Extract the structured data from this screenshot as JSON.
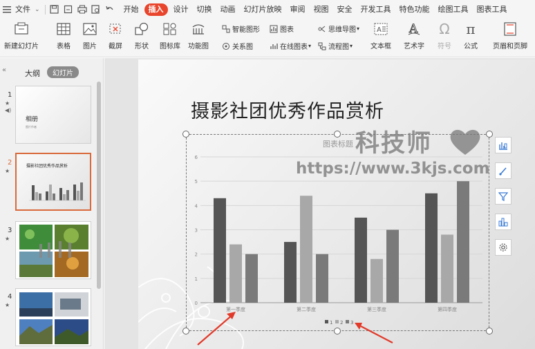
{
  "menu": {
    "file_label": "文件",
    "items": [
      "开始",
      "插入",
      "设计",
      "切换",
      "动画",
      "幻灯片放映",
      "审阅",
      "视图",
      "安全",
      "开发工具",
      "特色功能",
      "绘图工具",
      "图表工具"
    ],
    "active_index": 1
  },
  "ribbon": {
    "new_slide": "新建幻灯片",
    "table": "表格",
    "picture": "图片",
    "screenshot": "截屏",
    "shape": "形状",
    "icon_lib": "图标库",
    "func_chart": "功能图",
    "smartart": "智能图形",
    "chart": "图表",
    "relation": "关系图",
    "online_chart": "在线图表",
    "mindmap": "思维导图",
    "flowchart": "流程图",
    "textbox": "文本框",
    "wordart": "艺术字",
    "symbol": "符号",
    "formula": "公式",
    "header_footer": "页眉和页脚"
  },
  "panel": {
    "tab_outline": "大纲",
    "tab_slides": "幻灯片",
    "slides": [
      {
        "num": "1",
        "title": "相册",
        "subtitle": "图片作者"
      },
      {
        "num": "2",
        "title": "摄影社团优秀作品赏析"
      },
      {
        "num": "3"
      },
      {
        "num": "4"
      }
    ]
  },
  "slide": {
    "title": "摄影社团优秀作品赏析"
  },
  "watermark": {
    "line1": "科技师",
    "line2": "https://www.3kjs.com"
  },
  "chart_data": {
    "type": "bar",
    "title": "图表标题",
    "categories": [
      "第一季度",
      "第二季度",
      "第三季度",
      "第四季度"
    ],
    "series": [
      {
        "name": "1",
        "values": [
          4.3,
          2.5,
          3.5,
          4.5
        ],
        "color": "#555555"
      },
      {
        "name": "2",
        "values": [
          2.4,
          4.4,
          1.8,
          2.8
        ],
        "color": "#a8a8a8"
      },
      {
        "name": "3",
        "values": [
          2.0,
          2.0,
          3.0,
          5.0
        ],
        "color": "#7a7a7a"
      }
    ],
    "yticks": [
      "0",
      "1",
      "2",
      "3",
      "4",
      "5",
      "6"
    ],
    "ylim": [
      0,
      6
    ],
    "grid": true,
    "legend_position": "bottom"
  }
}
